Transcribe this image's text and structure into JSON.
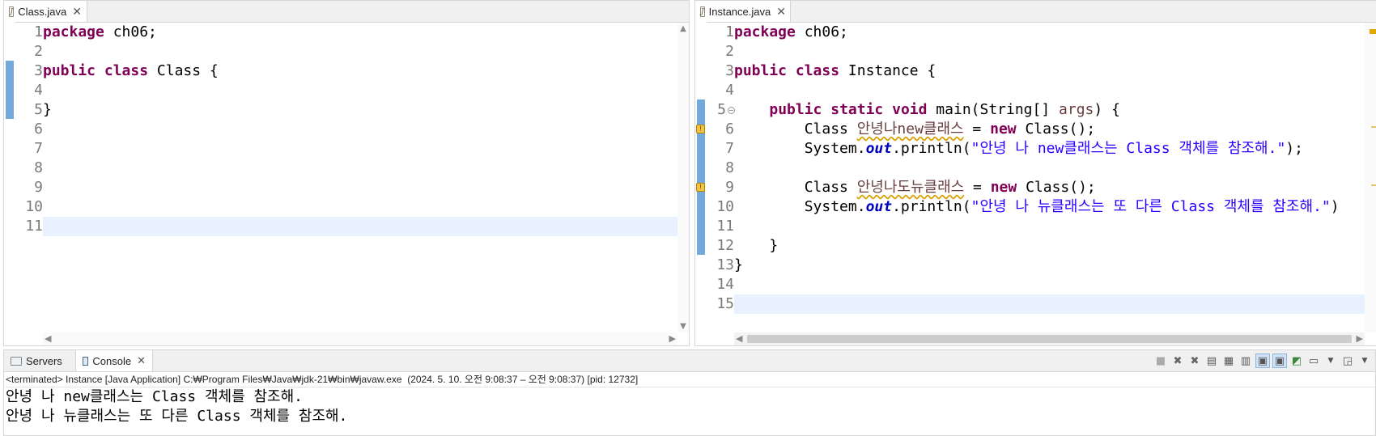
{
  "editors": [
    {
      "tab_title": "Class.java",
      "line_numbers": [
        "1",
        "2",
        "3",
        "4",
        "5",
        "6",
        "7",
        "8",
        "9",
        "10",
        "11"
      ]
    },
    {
      "tab_title": "Instance.java",
      "line_numbers": [
        "1",
        "2",
        "3",
        "4",
        "5",
        "6",
        "7",
        "8",
        "9",
        "10",
        "11",
        "12",
        "13",
        "14",
        "15"
      ]
    }
  ],
  "left_code": {
    "l1_kw": "package",
    "l1_rest": " ch06;",
    "l3_kw1": "public",
    "l3_kw2": "class",
    "l3_rest": " Class {",
    "l5": "}"
  },
  "right_code": {
    "l1_kw": "package",
    "l1_rest": " ch06;",
    "l3_kw1": "public",
    "l3_kw2": "class",
    "l3_rest": " Instance {",
    "l5_indent": "    ",
    "l5_kw1": "public",
    "l5_kw2": "static",
    "l5_kw3": "void",
    "l5_mid": " main(String[] ",
    "l5_args": "args",
    "l5_end": ") {",
    "l6_pre": "        Class ",
    "l6_var": "안녕나new클래스",
    "l6_mid": " = ",
    "l6_kw": "new",
    "l6_end": " Class();",
    "l7_pre": "        System.",
    "l7_out": "out",
    "l7_mid": ".println(",
    "l7_str": "\"안녕 나 new클래스는 Class 객체를 참조해.\"",
    "l7_end": ");",
    "l9_pre": "        Class ",
    "l9_var": "안녕나도뉴클래스",
    "l9_mid": " = ",
    "l9_kw": "new",
    "l9_end": " Class();",
    "l10_pre": "        System.",
    "l10_out": "out",
    "l10_mid": ".println(",
    "l10_str": "\"안녕 나 뉴클래스는 또 다른 Class 객체를 참조해.\"",
    "l10_end": ")",
    "l12": "    }",
    "l13": "}"
  },
  "console": {
    "tab_servers": "Servers",
    "tab_console": "Console",
    "status": "<terminated> Instance [Java Application] C:₩Program Files₩Java₩jdk-21₩bin₩javaw.exe  (2024. 5. 10. 오전 9:08:37 – 오전 9:08:37) [pid: 12732]",
    "output": [
      "안녕 나 new클래스는 Class 객체를 참조해.",
      "안녕 나 뉴클래스는 또 다른 Class 객체를 참조해."
    ]
  }
}
